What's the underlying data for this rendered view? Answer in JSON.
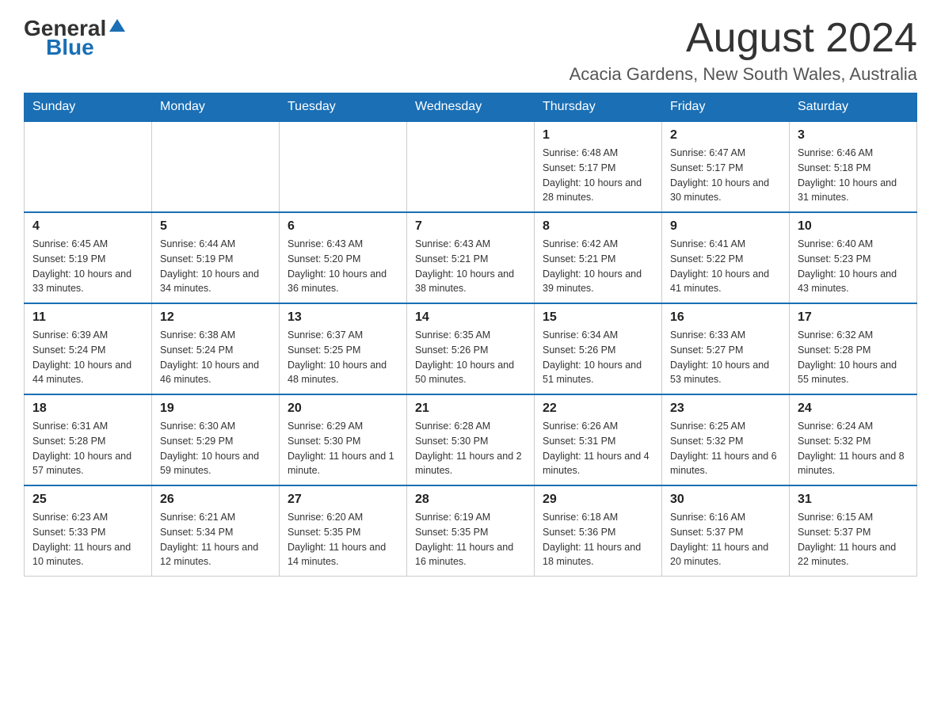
{
  "header": {
    "logo_general": "General",
    "logo_blue": "Blue",
    "month_title": "August 2024",
    "location": "Acacia Gardens, New South Wales, Australia"
  },
  "days_of_week": [
    "Sunday",
    "Monday",
    "Tuesday",
    "Wednesday",
    "Thursday",
    "Friday",
    "Saturday"
  ],
  "weeks": [
    [
      {
        "day": "",
        "info": ""
      },
      {
        "day": "",
        "info": ""
      },
      {
        "day": "",
        "info": ""
      },
      {
        "day": "",
        "info": ""
      },
      {
        "day": "1",
        "info": "Sunrise: 6:48 AM\nSunset: 5:17 PM\nDaylight: 10 hours and 28 minutes."
      },
      {
        "day": "2",
        "info": "Sunrise: 6:47 AM\nSunset: 5:17 PM\nDaylight: 10 hours and 30 minutes."
      },
      {
        "day": "3",
        "info": "Sunrise: 6:46 AM\nSunset: 5:18 PM\nDaylight: 10 hours and 31 minutes."
      }
    ],
    [
      {
        "day": "4",
        "info": "Sunrise: 6:45 AM\nSunset: 5:19 PM\nDaylight: 10 hours and 33 minutes."
      },
      {
        "day": "5",
        "info": "Sunrise: 6:44 AM\nSunset: 5:19 PM\nDaylight: 10 hours and 34 minutes."
      },
      {
        "day": "6",
        "info": "Sunrise: 6:43 AM\nSunset: 5:20 PM\nDaylight: 10 hours and 36 minutes."
      },
      {
        "day": "7",
        "info": "Sunrise: 6:43 AM\nSunset: 5:21 PM\nDaylight: 10 hours and 38 minutes."
      },
      {
        "day": "8",
        "info": "Sunrise: 6:42 AM\nSunset: 5:21 PM\nDaylight: 10 hours and 39 minutes."
      },
      {
        "day": "9",
        "info": "Sunrise: 6:41 AM\nSunset: 5:22 PM\nDaylight: 10 hours and 41 minutes."
      },
      {
        "day": "10",
        "info": "Sunrise: 6:40 AM\nSunset: 5:23 PM\nDaylight: 10 hours and 43 minutes."
      }
    ],
    [
      {
        "day": "11",
        "info": "Sunrise: 6:39 AM\nSunset: 5:24 PM\nDaylight: 10 hours and 44 minutes."
      },
      {
        "day": "12",
        "info": "Sunrise: 6:38 AM\nSunset: 5:24 PM\nDaylight: 10 hours and 46 minutes."
      },
      {
        "day": "13",
        "info": "Sunrise: 6:37 AM\nSunset: 5:25 PM\nDaylight: 10 hours and 48 minutes."
      },
      {
        "day": "14",
        "info": "Sunrise: 6:35 AM\nSunset: 5:26 PM\nDaylight: 10 hours and 50 minutes."
      },
      {
        "day": "15",
        "info": "Sunrise: 6:34 AM\nSunset: 5:26 PM\nDaylight: 10 hours and 51 minutes."
      },
      {
        "day": "16",
        "info": "Sunrise: 6:33 AM\nSunset: 5:27 PM\nDaylight: 10 hours and 53 minutes."
      },
      {
        "day": "17",
        "info": "Sunrise: 6:32 AM\nSunset: 5:28 PM\nDaylight: 10 hours and 55 minutes."
      }
    ],
    [
      {
        "day": "18",
        "info": "Sunrise: 6:31 AM\nSunset: 5:28 PM\nDaylight: 10 hours and 57 minutes."
      },
      {
        "day": "19",
        "info": "Sunrise: 6:30 AM\nSunset: 5:29 PM\nDaylight: 10 hours and 59 minutes."
      },
      {
        "day": "20",
        "info": "Sunrise: 6:29 AM\nSunset: 5:30 PM\nDaylight: 11 hours and 1 minute."
      },
      {
        "day": "21",
        "info": "Sunrise: 6:28 AM\nSunset: 5:30 PM\nDaylight: 11 hours and 2 minutes."
      },
      {
        "day": "22",
        "info": "Sunrise: 6:26 AM\nSunset: 5:31 PM\nDaylight: 11 hours and 4 minutes."
      },
      {
        "day": "23",
        "info": "Sunrise: 6:25 AM\nSunset: 5:32 PM\nDaylight: 11 hours and 6 minutes."
      },
      {
        "day": "24",
        "info": "Sunrise: 6:24 AM\nSunset: 5:32 PM\nDaylight: 11 hours and 8 minutes."
      }
    ],
    [
      {
        "day": "25",
        "info": "Sunrise: 6:23 AM\nSunset: 5:33 PM\nDaylight: 11 hours and 10 minutes."
      },
      {
        "day": "26",
        "info": "Sunrise: 6:21 AM\nSunset: 5:34 PM\nDaylight: 11 hours and 12 minutes."
      },
      {
        "day": "27",
        "info": "Sunrise: 6:20 AM\nSunset: 5:35 PM\nDaylight: 11 hours and 14 minutes."
      },
      {
        "day": "28",
        "info": "Sunrise: 6:19 AM\nSunset: 5:35 PM\nDaylight: 11 hours and 16 minutes."
      },
      {
        "day": "29",
        "info": "Sunrise: 6:18 AM\nSunset: 5:36 PM\nDaylight: 11 hours and 18 minutes."
      },
      {
        "day": "30",
        "info": "Sunrise: 6:16 AM\nSunset: 5:37 PM\nDaylight: 11 hours and 20 minutes."
      },
      {
        "day": "31",
        "info": "Sunrise: 6:15 AM\nSunset: 5:37 PM\nDaylight: 11 hours and 22 minutes."
      }
    ]
  ]
}
